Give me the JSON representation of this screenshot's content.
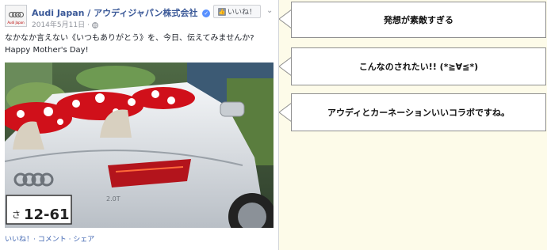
{
  "post": {
    "page_name": "Audi Japan / アウディジャパン株式会社",
    "date": "2014年5月11日 · ",
    "like_button_label": "いいね！",
    "message_line1": "なかなか言えない《いつもありがとう》を、今日、伝えてみませんか?",
    "message_line2": "Happy Mother's Day!",
    "plate_region": "さ",
    "plate_number": "12-61",
    "badge": "2.0T",
    "actions": "いいね！· コメント · シェア",
    "avatar_brand": "Audi Japan"
  },
  "comments": [
    {
      "text": "発想が素敵すぎる"
    },
    {
      "text": "こんなのされたい!! (*≧∀≦*)"
    },
    {
      "text": "アウディとカーネーションいいコラボですね。"
    }
  ],
  "colors": {
    "background": "#fdfbe9",
    "link_blue": "#3b5998",
    "action_blue": "#4267b2",
    "car_white": "#e9ecef",
    "carnation_red": "#d0101a"
  },
  "icons": {
    "verified": "check-badge-icon",
    "like": "thumbs-up-icon",
    "menu": "chevron-down-icon",
    "privacy": "globe-icon"
  }
}
